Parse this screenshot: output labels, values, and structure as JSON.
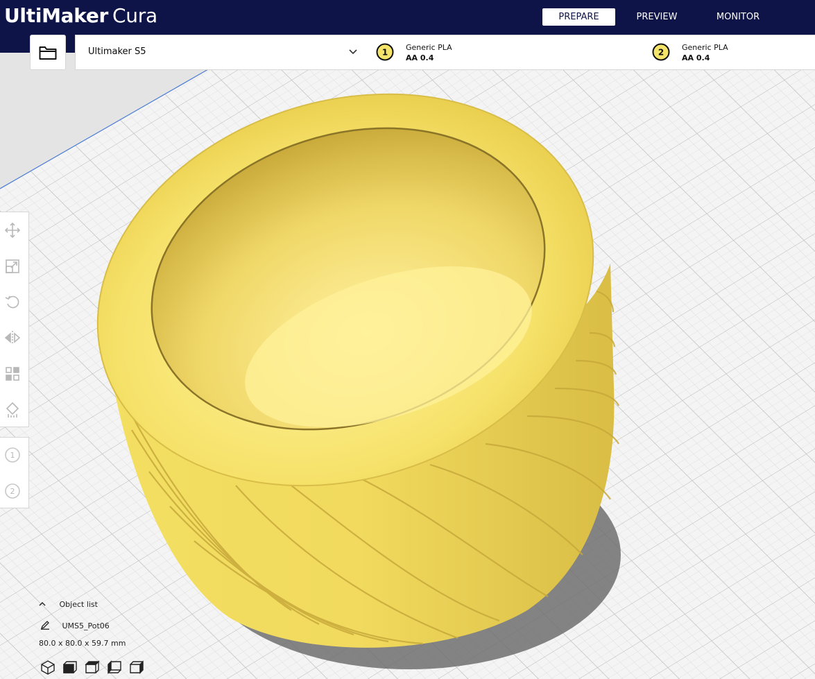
{
  "app": {
    "brand_bold": "UltiMaker",
    "brand_light": "Cura"
  },
  "nav": {
    "tabs": [
      {
        "label": "PREPARE",
        "active": true
      },
      {
        "label": "PREVIEW",
        "active": false
      },
      {
        "label": "MONITOR",
        "active": false
      }
    ]
  },
  "printer": {
    "name": "Ultimaker S5"
  },
  "extruders": [
    {
      "number": "1",
      "material": "Generic PLA",
      "nozzle": "AA 0.4"
    },
    {
      "number": "2",
      "material": "Generic PLA",
      "nozzle": "AA 0.4"
    }
  ],
  "object_list": {
    "toggle_label": "Object list",
    "object_name": "UMS5_Pot06",
    "dimensions": "80.0 x 80.0 x 59.7 mm"
  },
  "colors": {
    "header": "#0f1448",
    "model": "#f5e46a",
    "build_plate": "#f4f4f4",
    "grid": "#c8c8c8"
  }
}
